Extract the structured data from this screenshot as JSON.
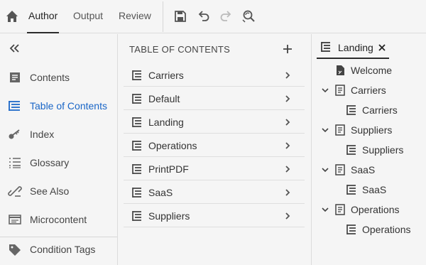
{
  "toolbar": {
    "tabs": [
      {
        "label": "Author",
        "active": true
      },
      {
        "label": "Output",
        "active": false
      },
      {
        "label": "Review",
        "active": false
      }
    ],
    "tools": [
      "save-icon",
      "undo-icon",
      "redo-icon",
      "find-replace-icon"
    ]
  },
  "sidebar": {
    "items": [
      {
        "label": "Contents",
        "icon": "contents-icon",
        "active": false
      },
      {
        "label": "Table of Contents",
        "icon": "toc-icon",
        "active": true
      },
      {
        "label": "Index",
        "icon": "key-icon",
        "active": false
      },
      {
        "label": "Glossary",
        "icon": "glossary-icon",
        "active": false
      },
      {
        "label": "See Also",
        "icon": "link-icon",
        "active": false
      },
      {
        "label": "Microcontent",
        "icon": "microcontent-icon",
        "active": false
      },
      {
        "label": "Condition Tags",
        "icon": "tag-icon",
        "active": false
      }
    ]
  },
  "toc_panel": {
    "title": "TABLE OF CONTENTS",
    "items": [
      "Carriers",
      "Default",
      "Landing",
      "Operations",
      "PrintPDF",
      "SaaS",
      "Suppliers"
    ]
  },
  "tree_panel": {
    "tab_label": "Landing",
    "close_symbol": "✕",
    "tree": [
      {
        "label": "Welcome",
        "level": 0,
        "type": "topic",
        "expanded": null
      },
      {
        "label": "Carriers",
        "level": 0,
        "type": "book",
        "expanded": true
      },
      {
        "label": "Carriers",
        "level": 1,
        "type": "toc",
        "expanded": null
      },
      {
        "label": "Suppliers",
        "level": 0,
        "type": "book",
        "expanded": true
      },
      {
        "label": "Suppliers",
        "level": 1,
        "type": "toc",
        "expanded": null
      },
      {
        "label": "SaaS",
        "level": 0,
        "type": "book",
        "expanded": true
      },
      {
        "label": "SaaS",
        "level": 1,
        "type": "toc",
        "expanded": null
      },
      {
        "label": "Operations",
        "level": 0,
        "type": "book",
        "expanded": true
      },
      {
        "label": "Operations",
        "level": 1,
        "type": "toc",
        "expanded": null
      }
    ]
  },
  "colors": {
    "accent": "#1a66c7",
    "text": "#2c2c2c",
    "background": "#f5f5f5"
  }
}
